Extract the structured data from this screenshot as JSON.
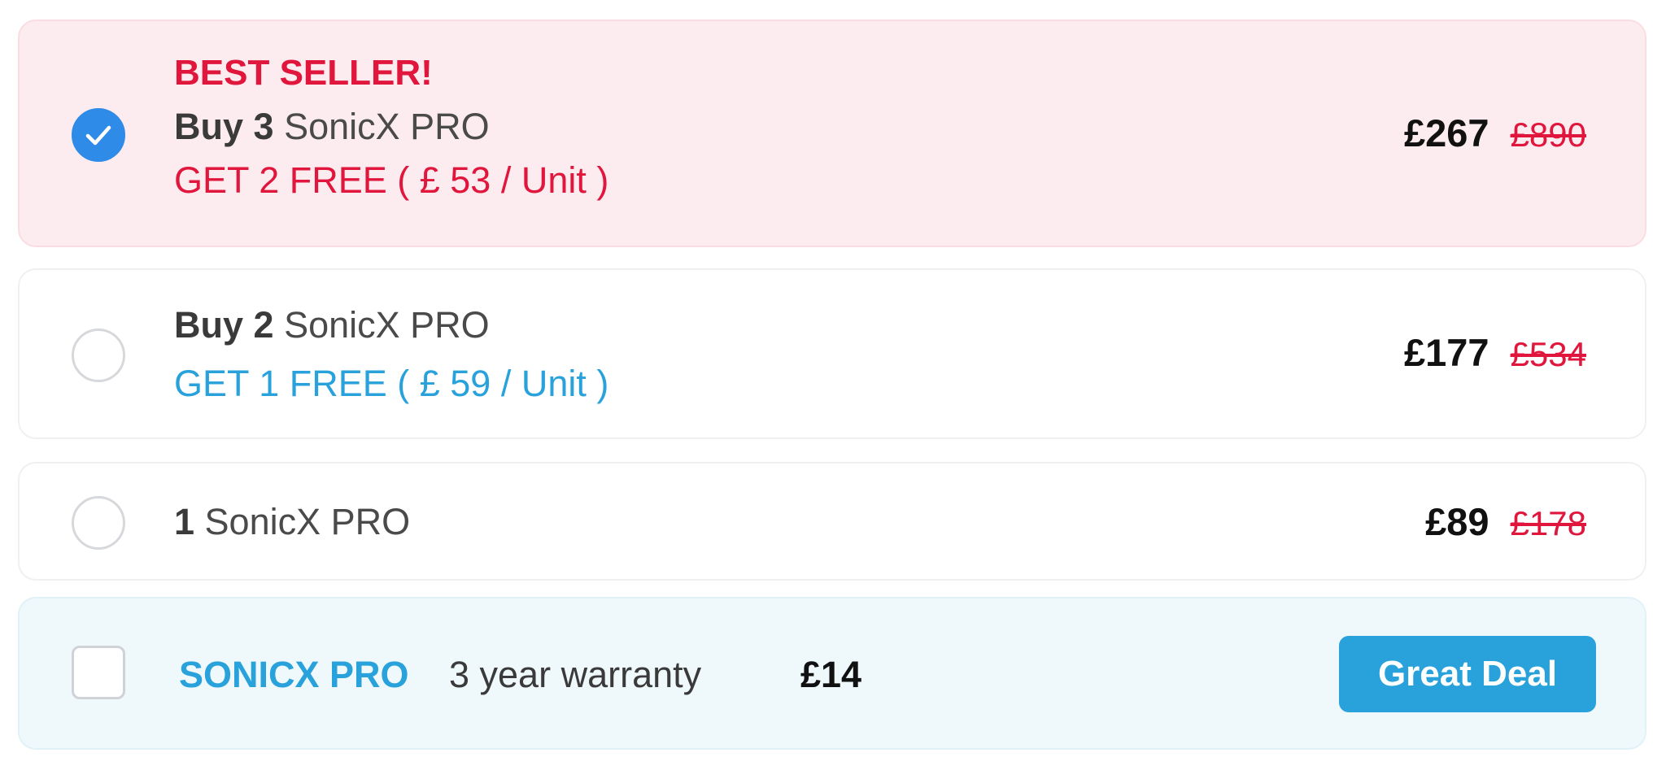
{
  "options": [
    {
      "badge": "BEST SELLER!",
      "buy_prefix": "Buy 3",
      "product": "SonicX PRO",
      "offer": "GET 2 FREE ( £ 53 / Unit )",
      "price": "£267",
      "old_price": "£890",
      "selected": true
    },
    {
      "buy_prefix": "Buy 2",
      "product": "SonicX PRO",
      "offer": "GET 1 FREE ( £ 59 / Unit )",
      "price": "£177",
      "old_price": "£534",
      "selected": false
    },
    {
      "buy_prefix": "1",
      "product": "SonicX PRO",
      "price": "£89",
      "old_price": "£178",
      "selected": false
    }
  ],
  "warranty": {
    "brand": "SONICX PRO",
    "label": "3 year warranty",
    "price": "£14",
    "button_label": "Great Deal",
    "checked": false
  },
  "colors": {
    "accent_red": "#e0163d",
    "accent_blue": "#29a2dc",
    "radio_checked": "#2f8be8",
    "selected_bg": "#fdecef",
    "warranty_bg": "#eff9fc"
  },
  "icons": {
    "selected_radio": "check-icon"
  }
}
